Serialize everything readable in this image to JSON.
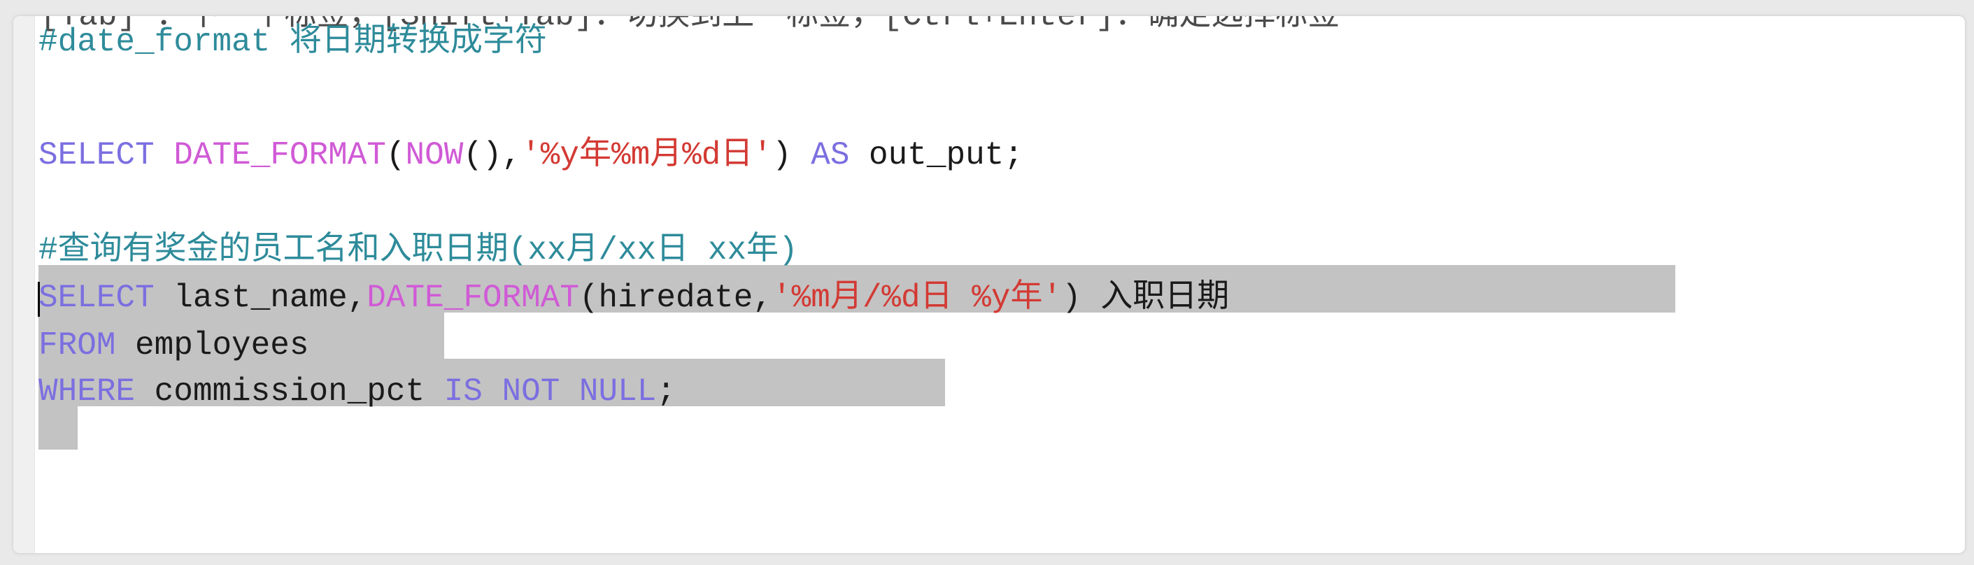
{
  "editor": {
    "clipped_top_line": "[Tab] ：下一个标签，[Shift+Tab]：切换到上一标签，[Ctrl+Enter]：确定选择标签",
    "lines": [
      {
        "tokens": [
          {
            "type": "comment",
            "text": "#date_format 将日期转换成字符"
          }
        ]
      },
      {
        "tokens": []
      },
      {
        "tokens": [
          {
            "type": "kw",
            "text": "SELECT "
          },
          {
            "type": "fn",
            "text": "DATE_FORMAT"
          },
          {
            "type": "plain",
            "text": "("
          },
          {
            "type": "fn",
            "text": "NOW"
          },
          {
            "type": "plain",
            "text": "(),"
          },
          {
            "type": "str",
            "text": "'%y年%m月%d日'"
          },
          {
            "type": "plain",
            "text": ") "
          },
          {
            "type": "kw",
            "text": "AS"
          },
          {
            "type": "plain",
            "text": " out_put;"
          }
        ]
      },
      {
        "tokens": []
      },
      {
        "tokens": [
          {
            "type": "comment",
            "text": "#查询有奖金的员工名和入职日期(xx月/xx日 xx年)"
          }
        ]
      },
      {
        "tokens": [
          {
            "type": "kw",
            "text": "SELECT"
          },
          {
            "type": "plain",
            "text": " last_name,"
          },
          {
            "type": "fn",
            "text": "DATE_FORMAT"
          },
          {
            "type": "plain",
            "text": "(hiredate,"
          },
          {
            "type": "str",
            "text": "'%m月/%d日 %y年'"
          },
          {
            "type": "plain",
            "text": ") 入职日期"
          }
        ]
      },
      {
        "tokens": [
          {
            "type": "kw",
            "text": "FROM"
          },
          {
            "type": "plain",
            "text": " employees"
          }
        ]
      },
      {
        "tokens": [
          {
            "type": "kw",
            "text": "WHERE"
          },
          {
            "type": "plain",
            "text": " commission_pct "
          },
          {
            "type": "kw",
            "text": "IS NOT NULL"
          },
          {
            "type": "plain",
            "text": ";"
          }
        ]
      }
    ]
  },
  "colors": {
    "comment": "#2e8b9a",
    "keyword": "#7b6fe0",
    "function": "#d05ad6",
    "string": "#d33a34",
    "selection": "#c3c3c3"
  }
}
